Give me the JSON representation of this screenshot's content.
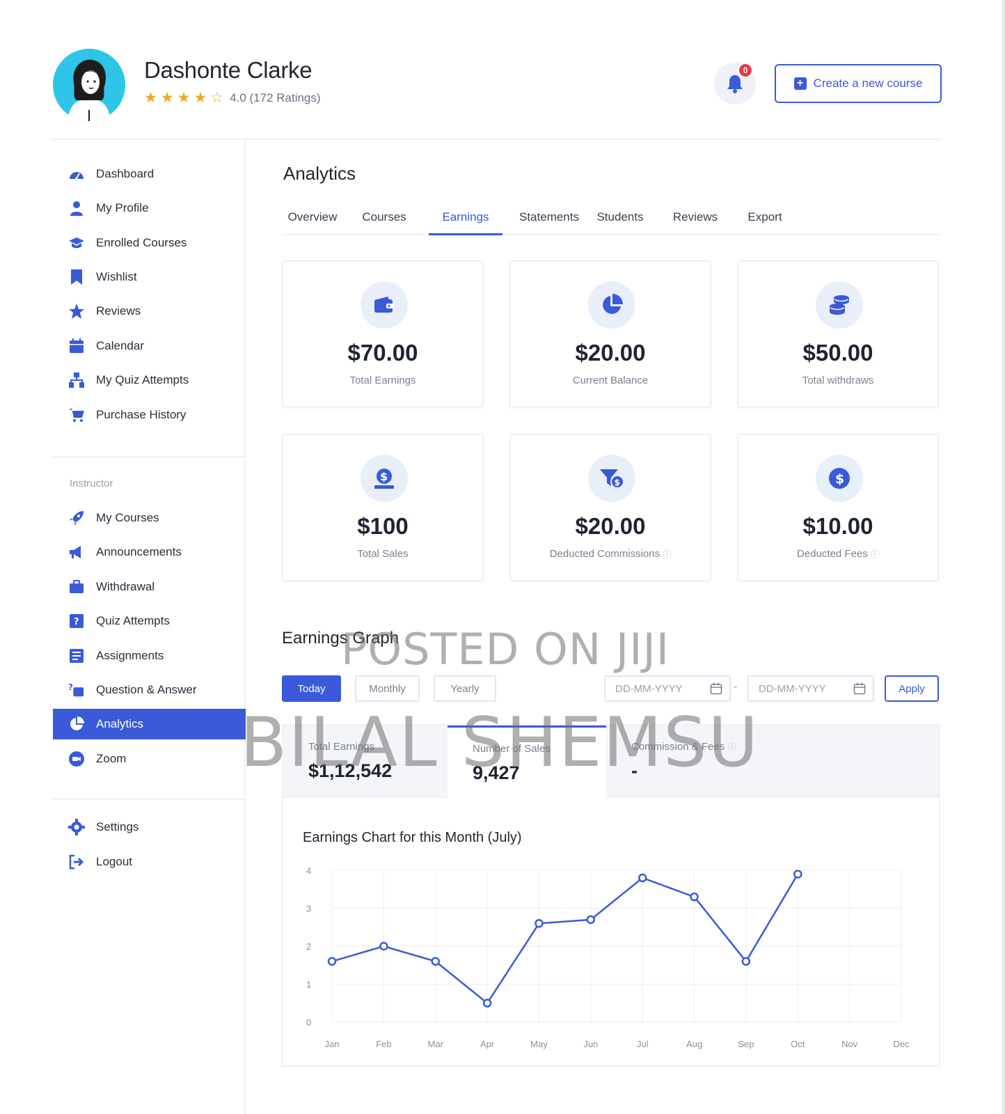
{
  "header": {
    "user_name": "Dashonte Clarke",
    "rating_text": "4.0 (172 Ratings)",
    "rating_value": 4,
    "rating_max": 5,
    "notification_count": "0",
    "create_button_label": "Create a new course"
  },
  "sidebar": {
    "items": [
      {
        "label": "Dashboard",
        "icon": "dashboard-icon"
      },
      {
        "label": "My Profile",
        "icon": "user-icon"
      },
      {
        "label": "Enrolled Courses",
        "icon": "graduation-cap-icon"
      },
      {
        "label": "Wishlist",
        "icon": "bookmark-icon"
      },
      {
        "label": "Reviews",
        "icon": "star-icon"
      },
      {
        "label": "Calendar",
        "icon": "calendar-icon"
      },
      {
        "label": "My Quiz Attempts",
        "icon": "quiz-icon"
      },
      {
        "label": "Purchase History",
        "icon": "cart-icon"
      }
    ],
    "section_label": "Instructor",
    "instructor_items": [
      {
        "label": "My Courses",
        "icon": "rocket-icon"
      },
      {
        "label": "Announcements",
        "icon": "megaphone-icon"
      },
      {
        "label": "Withdrawal",
        "icon": "briefcase-icon"
      },
      {
        "label": "Quiz Attempts",
        "icon": "quiz-icon"
      },
      {
        "label": "Assignments",
        "icon": "assignments-icon"
      },
      {
        "label": "Question & Answer",
        "icon": "question-icon"
      },
      {
        "label": "Analytics",
        "icon": "pie-chart-icon",
        "active": true
      },
      {
        "label": "Zoom",
        "icon": "zoom-icon"
      }
    ],
    "bottom_items": [
      {
        "label": "Settings",
        "icon": "gear-icon"
      },
      {
        "label": "Logout",
        "icon": "logout-icon"
      }
    ]
  },
  "main": {
    "title": "Analytics",
    "tabs": [
      "Overview",
      "Courses",
      "Earnings",
      "Statements",
      "Students",
      "Reviews",
      "Export"
    ],
    "active_tab": "Earnings",
    "cards": [
      {
        "value": "$70.00",
        "label": "Total Earnings",
        "icon": "wallet-icon"
      },
      {
        "value": "$20.00",
        "label": "Current Balance",
        "icon": "pie-chart-icon"
      },
      {
        "value": "$50.00",
        "label": "Total withdraws",
        "icon": "coins-icon"
      },
      {
        "value": "$100",
        "label": "Total Sales",
        "icon": "money-bag-icon"
      },
      {
        "value": "$20.00",
        "label": "Deducted Commissions",
        "icon": "funnel-dollar-icon"
      },
      {
        "value": "$10.00",
        "label": "Deducted Fees",
        "icon": "dollar-circle-icon"
      }
    ]
  },
  "graph": {
    "title": "Earnings Graph",
    "filters": [
      "Today",
      "Monthly",
      "Yearly"
    ],
    "active_filter": "Today",
    "date_placeholder": "DD-MM-YYYY",
    "date_separator": "-",
    "apply_label": "Apply",
    "stats": [
      {
        "label": "Total Earnings",
        "value": "$1,12,542"
      },
      {
        "label": "Number of Sales",
        "value": "9,427"
      },
      {
        "label": "Commission & Fees",
        "value": "-"
      }
    ],
    "active_stat": 1,
    "chart_title": "Earnings Chart for this Month (July)"
  },
  "watermark": {
    "line1": "POSTED ON JIJI",
    "line2": "BILAL SHEMSU"
  },
  "colors": {
    "accent": "#3a5ad9",
    "star": "#f5a623",
    "badge": "#e8384a",
    "avatar_bg": "#2ec5e8"
  },
  "chart_data": {
    "type": "line",
    "title": "Earnings Chart for this Month (July)",
    "categories": [
      "Jan",
      "Feb",
      "Mar",
      "Apr",
      "May",
      "Jun",
      "Jul",
      "Aug",
      "Sep",
      "Oct",
      "Nov",
      "Dec"
    ],
    "values": [
      1.6,
      2.0,
      1.6,
      0.5,
      2.6,
      2.7,
      3.8,
      3.3,
      1.6,
      3.9,
      null,
      null
    ],
    "ylim": [
      0,
      4
    ],
    "yticks": [
      0,
      1,
      2,
      3,
      4
    ],
    "grid": true,
    "color": "#3a5ad9"
  }
}
